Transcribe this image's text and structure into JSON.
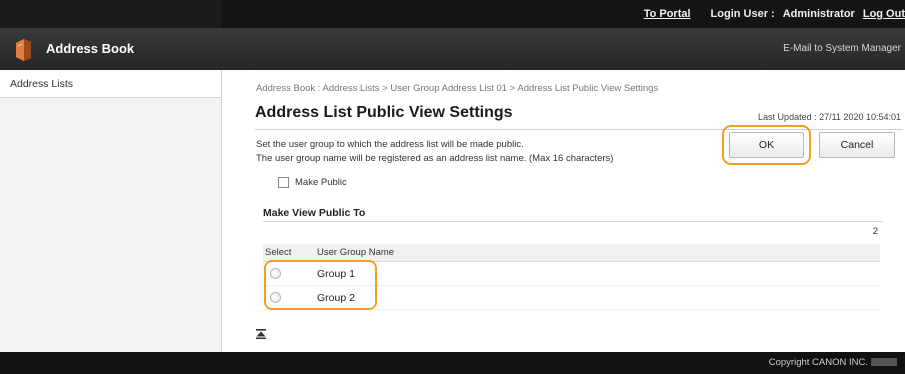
{
  "topbar": {
    "portal_link": "To Portal",
    "login_user_label": "Login User :",
    "login_user_name": "Administrator",
    "logout_link": "Log Out"
  },
  "appbar": {
    "icon": "address-book-icon",
    "title": "Address Book",
    "mail_link": "E-Mail to System Manager"
  },
  "sidebar": {
    "items": [
      {
        "label": "Address Lists"
      }
    ]
  },
  "main": {
    "breadcrumb": "Address Book : Address Lists > User Group Address List 01 > Address List Public View Settings",
    "title": "Address List Public View Settings",
    "last_updated": "Last Updated : 27/11 2020 10:54:01",
    "description_line1": "Set the user group to which the address list will be made public.",
    "description_line2": "The user group name will be registered as an address list name. (Max 16 characters)",
    "ok_button": "OK",
    "cancel_button": "Cancel",
    "make_public_label": "Make Public",
    "make_public_checked": false,
    "section_title": "Make View Public To",
    "count": "2",
    "table": {
      "columns": [
        "Select",
        "User Group Name"
      ],
      "rows": [
        {
          "name": "Group 1",
          "selected": false
        },
        {
          "name": "Group 2",
          "selected": false
        }
      ]
    },
    "scroll_top_icon": "scroll-to-top-icon"
  },
  "footer": {
    "copyright": "Copyright CANON INC."
  },
  "colors": {
    "highlight": "#f0a020",
    "topbar": "#141414",
    "appbar": "#2f2f2f",
    "footer": "#111111",
    "book_icon": "#c8652a"
  }
}
